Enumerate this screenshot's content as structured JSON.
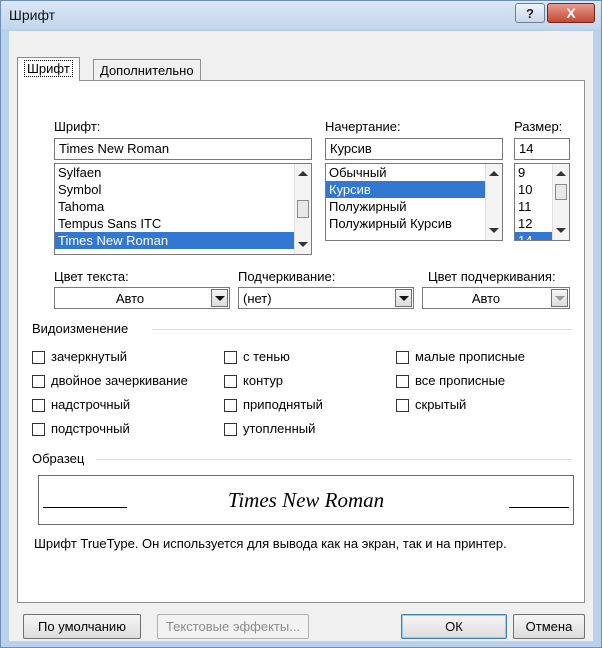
{
  "window": {
    "title": "Шрифт",
    "help_label": "?",
    "close_label": "X"
  },
  "tabs": [
    {
      "label": "Шрифт",
      "active": true
    },
    {
      "label": "Дополнительно",
      "active": false
    }
  ],
  "font": {
    "label": "Шрифт:",
    "value": "Times New Roman",
    "items": [
      "Sylfaen",
      "Symbol",
      "Tahoma",
      "Tempus Sans ITC",
      "Times New Roman"
    ],
    "selected": "Times New Roman"
  },
  "style": {
    "label": "Начертание:",
    "value": "Курсив",
    "items": [
      "Обычный",
      "Курсив",
      "Полужирный",
      "Полужирный Курсив"
    ],
    "selected": "Курсив"
  },
  "size": {
    "label": "Размер:",
    "value": "14",
    "items": [
      "9",
      "10",
      "11",
      "12",
      "14"
    ],
    "selected": "14"
  },
  "text_color": {
    "label": "Цвет текста:",
    "value": "Авто"
  },
  "underline": {
    "label": "Подчеркивание:",
    "value": "(нет)"
  },
  "underline_color": {
    "label": "Цвет подчеркивания:",
    "value": "Авто"
  },
  "effects": {
    "group_label": "Видоизменение",
    "items": [
      {
        "label": "зачеркнутый",
        "checked": false
      },
      {
        "label": "двойное зачеркивание",
        "checked": false
      },
      {
        "label": "надстрочный",
        "checked": false
      },
      {
        "label": "подстрочный",
        "checked": false
      },
      {
        "label": "с тенью",
        "checked": false
      },
      {
        "label": "контур",
        "checked": false
      },
      {
        "label": "приподнятый",
        "checked": false
      },
      {
        "label": "утопленный",
        "checked": false
      },
      {
        "label": "малые прописные",
        "checked": false
      },
      {
        "label": "все прописные",
        "checked": false
      },
      {
        "label": "скрытый",
        "checked": false
      }
    ]
  },
  "preview": {
    "group_label": "Образец",
    "text": "Times New Roman",
    "note": "Шрифт TrueType. Он используется для вывода как на экран, так и на принтер."
  },
  "buttons": {
    "default_label": "По умолчанию",
    "text_effects_label": "Текстовые эффекты...",
    "ok_label": "ОК",
    "cancel_label": "Отмена"
  },
  "colors": {
    "selection": "#3278d2",
    "title_bar": "#c2d6ec",
    "close_button": "#c24a36"
  }
}
